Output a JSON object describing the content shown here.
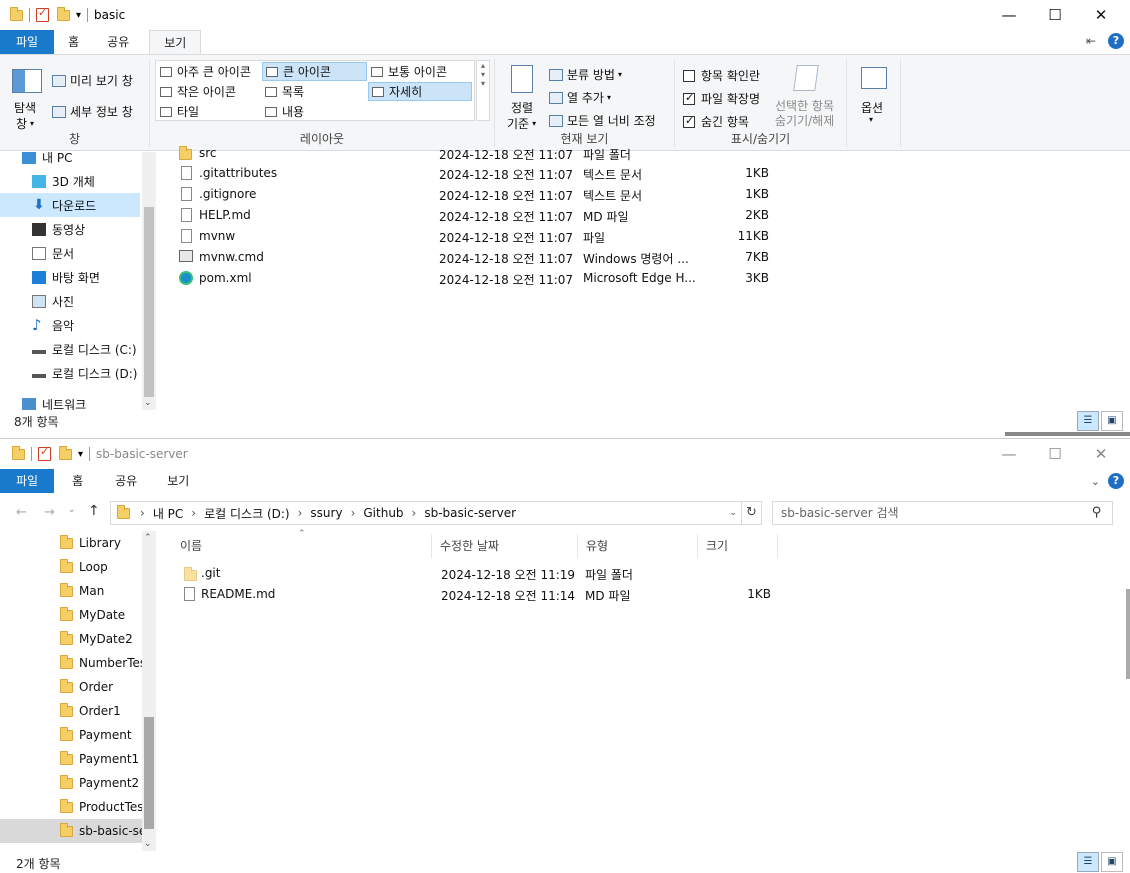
{
  "win1": {
    "title": "basic",
    "tabs": {
      "file": "파일",
      "home": "홈",
      "share": "공유",
      "view": "보기"
    },
    "ribbon": {
      "pane": {
        "nav_pane": "탐색",
        "nav_pane2": "창",
        "preview": "미리 보기 창",
        "details": "세부 정보 창",
        "label": "창"
      },
      "layout": {
        "items": [
          "아주 큰 아이콘",
          "큰 아이콘",
          "보통 아이콘",
          "작은 아이콘",
          "목록",
          "자세히",
          "타일",
          "내용"
        ],
        "label": "레이아웃"
      },
      "current": {
        "sort": "정렬",
        "sort2": "기준",
        "group": "분류 방법",
        "addcol": "열 추가",
        "fit": "모든 열 너비 조정",
        "label": "현재 보기"
      },
      "show": {
        "checkboxes": "항목 확인란",
        "ext": "파일 확장명",
        "hidden": "숨긴 항목",
        "hide_sel": "선택한 항목",
        "hide_sel2": "숨기기/해제",
        "label": "표시/숨기기"
      },
      "options": "옵션"
    },
    "nav": [
      "내 PC",
      "3D 개체",
      "다운로드",
      "동영상",
      "문서",
      "바탕 화면",
      "사진",
      "음악",
      "로컬 디스크 (C:)",
      "로컬 디스크 (D:)",
      "네트워크"
    ],
    "files": [
      {
        "name": "src",
        "date": "2024-12-18 오전 11:07",
        "type": "파일 폴더",
        "size": ""
      },
      {
        "name": ".gitattributes",
        "date": "2024-12-18 오전 11:07",
        "type": "텍스트 문서",
        "size": "1KB"
      },
      {
        "name": ".gitignore",
        "date": "2024-12-18 오전 11:07",
        "type": "텍스트 문서",
        "size": "1KB"
      },
      {
        "name": "HELP.md",
        "date": "2024-12-18 오전 11:07",
        "type": "MD 파일",
        "size": "2KB"
      },
      {
        "name": "mvnw",
        "date": "2024-12-18 오전 11:07",
        "type": "파일",
        "size": "11KB"
      },
      {
        "name": "mvnw.cmd",
        "date": "2024-12-18 오전 11:07",
        "type": "Windows 명령어 ...",
        "size": "7KB"
      },
      {
        "name": "pom.xml",
        "date": "2024-12-18 오전 11:07",
        "type": "Microsoft Edge H...",
        "size": "3KB"
      }
    ],
    "status": "8개 항목"
  },
  "win2": {
    "title": "sb-basic-server",
    "tabs": {
      "file": "파일",
      "home": "홈",
      "share": "공유",
      "view": "보기"
    },
    "breadcrumb": [
      "내 PC",
      "로컬 디스크 (D:)",
      "ssury",
      "Github",
      "sb-basic-server"
    ],
    "search_placeholder": "sb-basic-server 검색",
    "columns": {
      "name": "이름",
      "date": "수정한 날짜",
      "type": "유형",
      "size": "크기"
    },
    "nav": [
      "Library",
      "Loop",
      "Man",
      "MyDate",
      "MyDate2",
      "NumberTest",
      "Order",
      "Order1",
      "Payment",
      "Payment1",
      "Payment2",
      "ProductTest",
      "sb-basic-server"
    ],
    "files": [
      {
        "name": ".git",
        "date": "2024-12-18 오전 11:19",
        "type": "파일 폴더",
        "size": ""
      },
      {
        "name": "README.md",
        "date": "2024-12-18 오전 11:14",
        "type": "MD 파일",
        "size": "1KB"
      }
    ],
    "status": "2개 항목"
  },
  "colors": {
    "accent": "#1979ca",
    "selection": "#cce8ff"
  }
}
